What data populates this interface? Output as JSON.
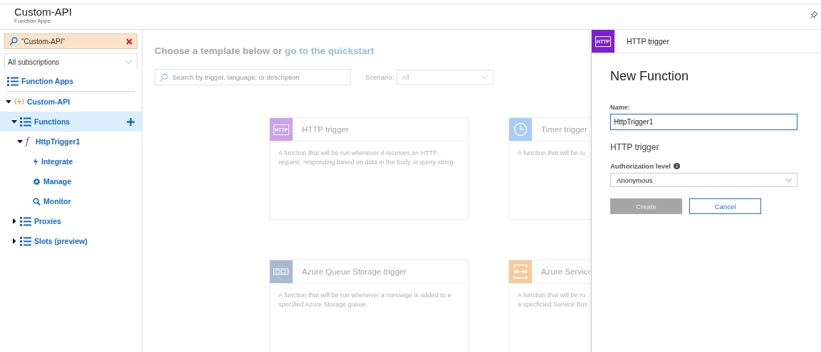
{
  "header": {
    "title": "Custom-API",
    "subtitle": "Function Apps"
  },
  "sidebar": {
    "search": {
      "value": "\"Custom-API\""
    },
    "subscription": {
      "value": "All subscriptions"
    },
    "root": {
      "label": "Function Apps",
      "kind": "list"
    },
    "tree": [
      {
        "label": "Custom-API",
        "kind": "app",
        "expanded": true,
        "selected": false,
        "children": [
          {
            "label": "Functions",
            "kind": "list",
            "expanded": true,
            "selected": true,
            "add_button": true,
            "children": [
              {
                "label": "HttpTrigger1",
                "kind": "function",
                "icon_char": "f",
                "expanded": true,
                "selected": false,
                "children": [
                  {
                    "label": "Integrate",
                    "kind": "bolt",
                    "selected": false
                  },
                  {
                    "label": "Manage",
                    "kind": "gear",
                    "selected": false
                  },
                  {
                    "label": "Monitor",
                    "kind": "search",
                    "selected": false
                  }
                ]
              }
            ]
          },
          {
            "label": "Proxies",
            "kind": "list",
            "expanded": false,
            "selected": false
          },
          {
            "label": "Slots (preview)",
            "kind": "list",
            "expanded": false,
            "selected": false
          }
        ]
      }
    ]
  },
  "main": {
    "heading": "Choose a template below or",
    "heading_link": "go to the quickstart",
    "search": {
      "placeholder": "Search by trigger, language, or description"
    },
    "scenario": {
      "label": "Scenario:",
      "value": "All"
    },
    "templates": [
      {
        "title": "HTTP trigger",
        "description": "A function that will be run whenever it receives an HTTP request, responding based on data in the body or query string",
        "kind": "http",
        "icon_text": "HTTP",
        "color": "#c9a3ec"
      },
      {
        "title": "Timer trigger",
        "description": "A function that will be ru",
        "kind": "timer",
        "color": "#abcbf7"
      },
      {
        "title": "Azure Queue Storage trigger",
        "description": "A function that will be run whenever a message is added to a specified Azure Storage queue",
        "kind": "queue",
        "color": "#a7bbd1"
      },
      {
        "title": "Azure Service",
        "description": "A function that will be ru\na specficied Service Bus",
        "kind": "servicebus",
        "color": "#f9c99b"
      }
    ]
  },
  "panel": {
    "header": {
      "title": "HTTP trigger",
      "icon_text": "HTTP"
    },
    "title": "New Function",
    "name_label": "Name:",
    "name_value": "HttpTrigger1",
    "section": "HTTP trigger",
    "auth_label": "Authorization level",
    "auth_value": "Anonymous",
    "buttons": [
      {
        "label": "Create",
        "kind": "primary",
        "disabled": true
      },
      {
        "label": "Cancel",
        "kind": "secondary",
        "disabled": false
      }
    ]
  }
}
